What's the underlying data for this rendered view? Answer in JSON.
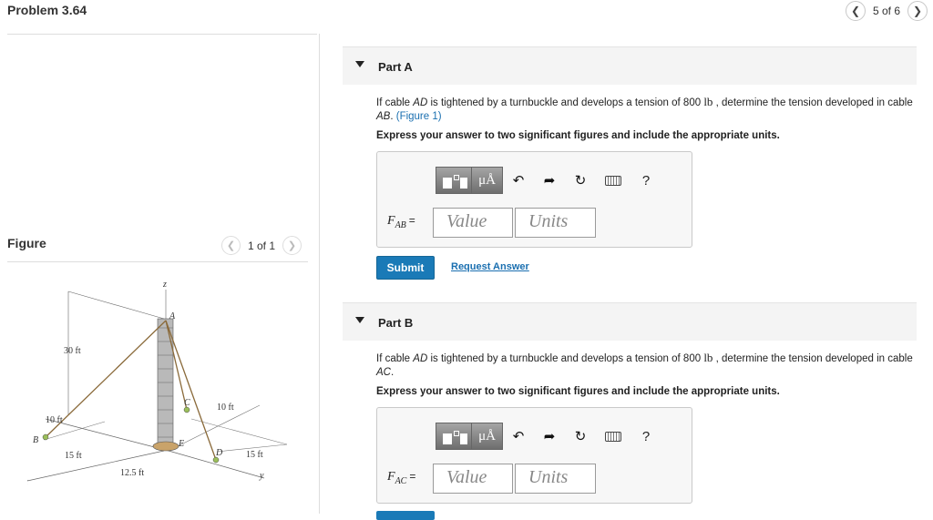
{
  "header": {
    "title": "Problem 3.64",
    "pager_text": "5 of 6",
    "prev_icon": "chevron-left-icon",
    "next_icon": "chevron-right-icon"
  },
  "figure_panel": {
    "label": "Figure",
    "pager_text": "1 of 1",
    "labels": {
      "z": "z",
      "A": "A",
      "B": "B",
      "C": "C",
      "D": "D",
      "E": "E",
      "x": "x",
      "y": "y",
      "dim_30ft": "30 ft",
      "dim_10ft_left": "10 ft",
      "dim_15ft_left": "15 ft",
      "dim_12_5ft": "12.5 ft",
      "dim_10ft_right": "10 ft",
      "dim_15ft_right": "15 ft"
    }
  },
  "parts": [
    {
      "label": "Part A",
      "question_before": "If cable ",
      "question_cable1": "AD",
      "question_mid": " is tightened by a turnbuckle and develops a tension of 800 ",
      "question_unit": "lb",
      "question_mid2": " , determine the tension developed in cable ",
      "question_cable2": "AB",
      "question_end": ". ",
      "figure_link": "(Figure 1)",
      "instruction": "Express your answer to two significant figures and include the appropriate units.",
      "var_main": "F",
      "var_sub": "AB",
      "equals": "=",
      "value_placeholder": "Value",
      "units_placeholder": "Units",
      "submit_label": "Submit",
      "request_label": "Request Answer"
    },
    {
      "label": "Part B",
      "question_before": "If cable ",
      "question_cable1": "AD",
      "question_mid": " is tightened by a turnbuckle and develops a tension of 800 ",
      "question_unit": "lb",
      "question_mid2": " , determine the tension developed in cable ",
      "question_cable2": "AC",
      "question_end": ".",
      "instruction": "Express your answer to two significant figures and include the appropriate units.",
      "var_main": "F",
      "var_sub": "AC",
      "equals": "=",
      "value_placeholder": "Value",
      "units_placeholder": "Units"
    }
  ],
  "toolbar": {
    "symbols_label": "μÅ",
    "undo_icon": "undo-icon",
    "redo_icon": "redo-icon",
    "reset_icon": "reset-icon",
    "keyboard_icon": "keyboard-icon",
    "help_label": "?"
  }
}
